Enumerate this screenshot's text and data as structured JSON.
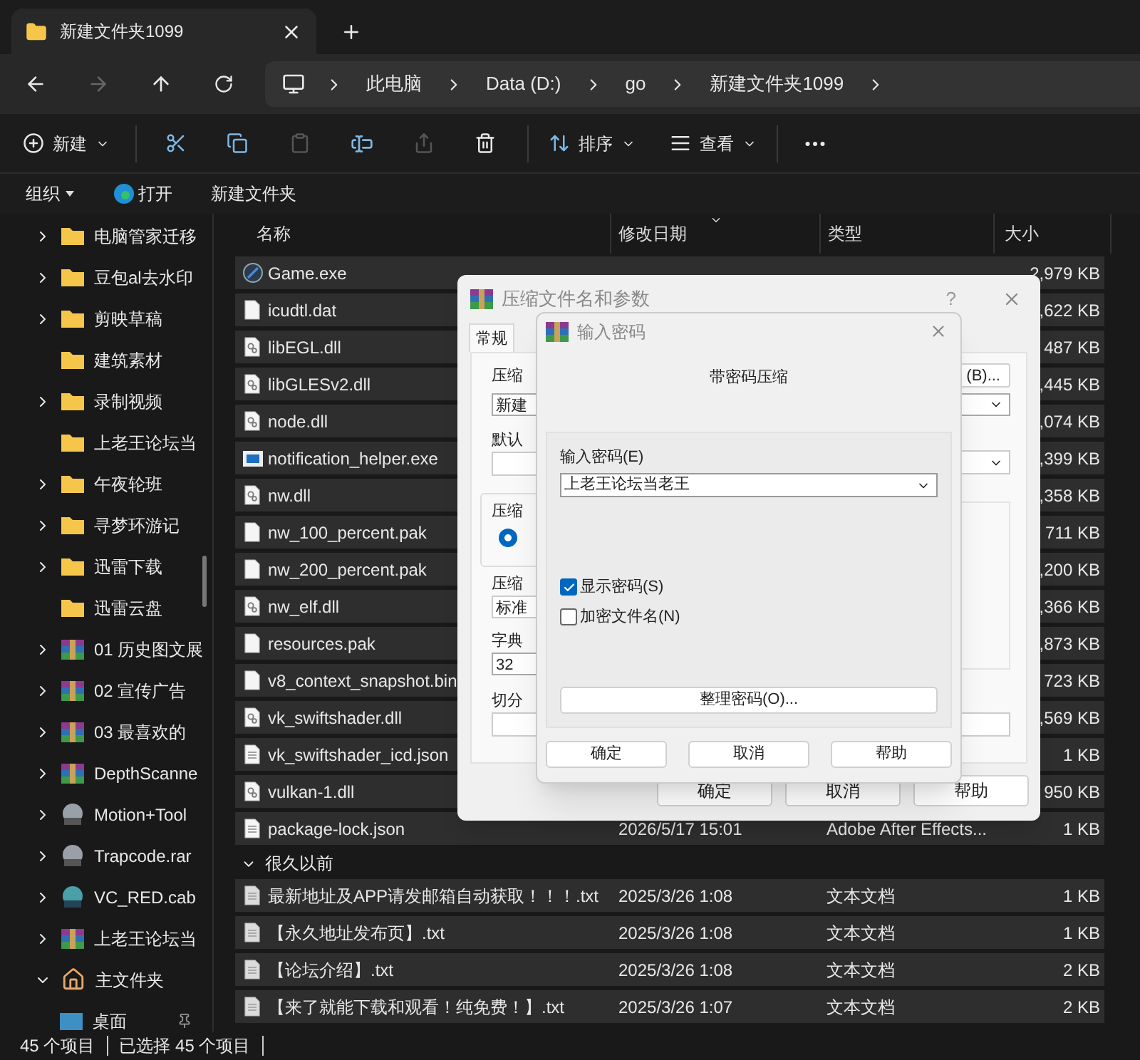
{
  "tab": {
    "title": "新建文件夹1099"
  },
  "breadcrumb": [
    "此电脑",
    "Data (D:)",
    "go",
    "新建文件夹1099"
  ],
  "toolbar": {
    "new_label": "新建",
    "sort_label": "排序",
    "view_label": "查看"
  },
  "command_bar": {
    "organize": "组织",
    "open": "打开",
    "new_folder": "新建文件夹"
  },
  "sidebar": {
    "items": [
      {
        "label": "电脑管家迁移",
        "kind": "folder",
        "expandable": true,
        "expanded": false
      },
      {
        "label": "豆包al去水印",
        "kind": "folder",
        "expandable": true,
        "expanded": false
      },
      {
        "label": "剪映草稿",
        "kind": "folder",
        "expandable": true,
        "expanded": false
      },
      {
        "label": "建筑素材",
        "kind": "folder",
        "expandable": false
      },
      {
        "label": "录制视频",
        "kind": "folder",
        "expandable": true,
        "expanded": false
      },
      {
        "label": "上老王论坛当",
        "kind": "folder",
        "expandable": false
      },
      {
        "label": "午夜轮班",
        "kind": "folder",
        "expandable": true,
        "expanded": false
      },
      {
        "label": "寻梦环游记",
        "kind": "folder",
        "expandable": true,
        "expanded": false
      },
      {
        "label": "迅雷下载",
        "kind": "folder",
        "expandable": true,
        "expanded": false
      },
      {
        "label": "迅雷云盘",
        "kind": "folder",
        "expandable": false
      },
      {
        "label": "01 历史图文展",
        "kind": "archive",
        "expandable": true,
        "expanded": false
      },
      {
        "label": "02 宣传广告",
        "kind": "archive",
        "expandable": true,
        "expanded": false
      },
      {
        "label": "03 最喜欢的",
        "kind": "archive",
        "expandable": true,
        "expanded": false
      },
      {
        "label": "DepthScanne",
        "kind": "archive",
        "expandable": true,
        "expanded": false
      },
      {
        "label": "Motion+Tool",
        "kind": "rar",
        "expandable": true,
        "expanded": false
      },
      {
        "label": "Trapcode.rar",
        "kind": "rar",
        "expandable": true,
        "expanded": false
      },
      {
        "label": "VC_RED.cab",
        "kind": "cab",
        "expandable": true,
        "expanded": false
      },
      {
        "label": "上老王论坛当",
        "kind": "archive",
        "expandable": true,
        "expanded": false
      },
      {
        "label": "主文件夹",
        "kind": "home",
        "expandable": true,
        "expanded": true,
        "children": [
          {
            "label": "桌面",
            "kind": "desktop",
            "expandable": false,
            "pinned": true
          }
        ]
      }
    ]
  },
  "table": {
    "columns": [
      "名称",
      "修改日期",
      "类型",
      "大小"
    ],
    "rows": [
      {
        "name": "Game.exe",
        "kind": "game",
        "size": "2,979 KB",
        "selected": true
      },
      {
        "name": "icudtl.dat",
        "kind": "blank",
        "size": ",622 KB",
        "selected": true
      },
      {
        "name": "libEGL.dll",
        "kind": "dll",
        "size": "487 KB",
        "selected": true
      },
      {
        "name": "libGLESv2.dll",
        "kind": "dll",
        "size": ",445 KB",
        "selected": true
      },
      {
        "name": "node.dll",
        "kind": "dll",
        "size": ",074 KB",
        "selected": true
      },
      {
        "name": "notification_helper.exe",
        "kind": "window",
        "size": ",399 KB",
        "selected": true
      },
      {
        "name": "nw.dll",
        "kind": "dll",
        "size": ",358 KB",
        "selected": true
      },
      {
        "name": "nw_100_percent.pak",
        "kind": "blank",
        "size": "711 KB",
        "selected": true
      },
      {
        "name": "nw_200_percent.pak",
        "kind": "blank",
        "size": ",200 KB",
        "selected": true
      },
      {
        "name": "nw_elf.dll",
        "kind": "dll",
        "size": ",366 KB",
        "selected": true
      },
      {
        "name": "resources.pak",
        "kind": "blank",
        "size": ",873 KB",
        "selected": true
      },
      {
        "name": "v8_context_snapshot.bin",
        "kind": "blank",
        "size": "723 KB",
        "selected": true
      },
      {
        "name": "vk_swiftshader.dll",
        "kind": "dll",
        "size": ",569 KB",
        "selected": true
      },
      {
        "name": "vk_swiftshader_icd.json",
        "kind": "lines",
        "size": "1 KB",
        "selected": true
      },
      {
        "name": "vulkan-1.dll",
        "kind": "dll",
        "size": "950 KB",
        "selected": true
      },
      {
        "name": "package-lock.json",
        "kind": "lines",
        "date": "2026/5/17 15:01",
        "type": "Adobe After Effects...",
        "size": "1 KB",
        "selected": true
      }
    ],
    "group": {
      "label": "很久以前",
      "expanded": true
    },
    "group_rows": [
      {
        "name": "最新地址及APP请发邮箱自动获取！！！.txt",
        "kind": "txt",
        "date": "2025/3/26 1:08",
        "type": "文本文档",
        "size": "1 KB",
        "selected": true
      },
      {
        "name": "【永久地址发布页】.txt",
        "kind": "txt",
        "date": "2025/3/26 1:08",
        "type": "文本文档",
        "size": "1 KB",
        "selected": true
      },
      {
        "name": "【论坛介绍】.txt",
        "kind": "txt",
        "date": "2025/3/26 1:08",
        "type": "文本文档",
        "size": "2 KB",
        "selected": true
      },
      {
        "name": "【来了就能下载和观看！纯免费！】.txt",
        "kind": "txt",
        "date": "2025/3/26 1:07",
        "type": "文本文档",
        "size": "2 KB",
        "selected": true
      }
    ]
  },
  "status_bar": {
    "count": "45 个项目",
    "selection": "已选择 45 个项目"
  },
  "archive_dialog": {
    "title": "压缩文件名和参数",
    "help": "?",
    "tabs": [
      {
        "label": "常规",
        "selected": true
      }
    ],
    "left_fragments": {
      "archive_label": "压缩",
      "archive_value": "新建",
      "profile_label": "默认",
      "format_group": "压缩",
      "method_label": "压缩",
      "method_value": "标准",
      "dict_label": "字典",
      "dict_value": "32",
      "split_label": "切分"
    },
    "browse_fragment": "(B)...",
    "format_option_selected": true,
    "buttons": [
      "确定",
      "取消",
      "帮助"
    ]
  },
  "password_dialog": {
    "title": "输入密码",
    "heading": "带密码压缩",
    "password_label": "输入密码(E)",
    "password_value": "上老王论坛当老王",
    "checkboxes": [
      {
        "label": "显示密码(S)",
        "checked": true
      },
      {
        "label": "加密文件名(N)",
        "checked": false
      }
    ],
    "manage_button": "整理密码(O)...",
    "buttons": [
      "确定",
      "取消",
      "帮助"
    ]
  }
}
